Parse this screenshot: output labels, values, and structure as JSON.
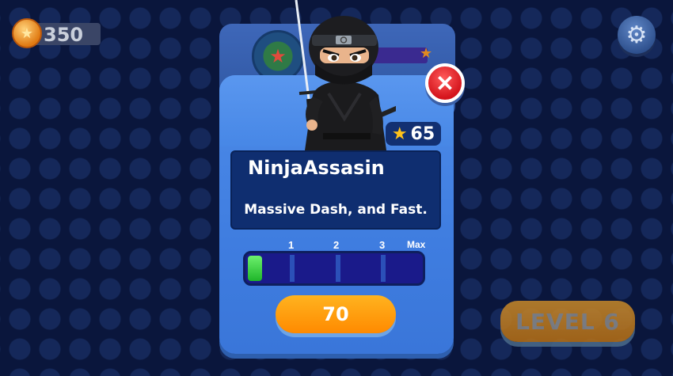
{
  "hud": {
    "coins": "350",
    "level_label": "LEVEL 6"
  },
  "character": {
    "name": "NinjaAssasin",
    "description": "Massive Dash, and Fast.",
    "stars": "65"
  },
  "upgrade": {
    "ticks": [
      "1",
      "2",
      "3",
      "Max"
    ],
    "current_level": 0,
    "max_level": 4
  },
  "buy_button": {
    "price": "70"
  },
  "colors": {
    "background": "#0c1a44",
    "modal": "#4d8be8",
    "panel": "#0f2e70",
    "upgrade_fill": "#1fb62a",
    "buy_button": "#ff8a00",
    "close_button": "#d4141c",
    "level_button": "#c98a2a"
  },
  "icons": [
    "coin-icon",
    "settings-gear-icon",
    "close-x-icon",
    "star-icon",
    "rank-badge-icon"
  ]
}
